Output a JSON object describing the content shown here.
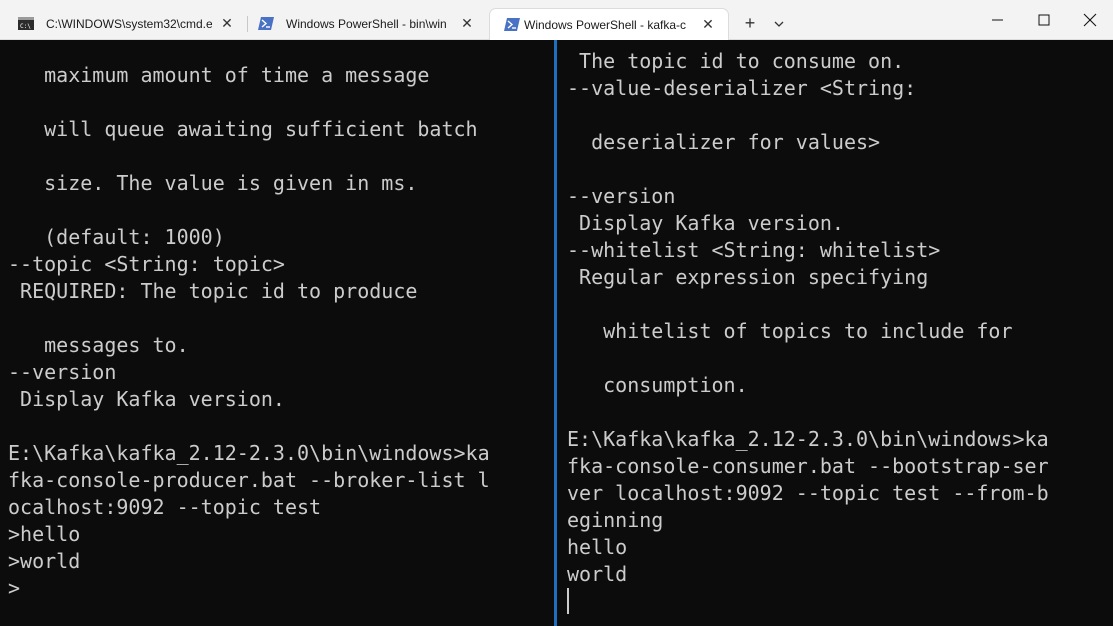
{
  "tabs": [
    {
      "title": "C:\\WINDOWS\\system32\\cmd.e",
      "icon": "cmd-icon",
      "active": false
    },
    {
      "title": "Windows PowerShell - bin\\win",
      "icon": "powershell-icon",
      "active": false
    },
    {
      "title": "Windows PowerShell - kafka-c",
      "icon": "powershell-icon",
      "active": true
    }
  ],
  "titlebar": {
    "new_tab": "+",
    "close_glyph": "✕"
  },
  "left_pane": {
    "lines": [
      "",
      "   maximum amount of time a message",
      "",
      "   will queue awaiting sufficient batch",
      "",
      "   size. The value is given in ms.",
      "",
      "   (default: 1000)",
      "--topic <String: topic>",
      " REQUIRED: The topic id to produce",
      "",
      "   messages to.",
      "--version",
      " Display Kafka version.",
      "",
      "E:\\Kafka\\kafka_2.12-2.3.0\\bin\\windows>ka",
      "fka-console-producer.bat --broker-list l",
      "ocalhost:9092 --topic test",
      ">hello",
      ">world",
      ">"
    ]
  },
  "right_pane": {
    "lines": [
      " The topic id to consume on.",
      "--value-deserializer <String:",
      "",
      "  deserializer for values>",
      "",
      "--version",
      " Display Kafka version.",
      "--whitelist <String: whitelist>",
      " Regular expression specifying",
      "",
      "   whitelist of topics to include for",
      "",
      "   consumption.",
      "",
      "E:\\Kafka\\kafka_2.12-2.3.0\\bin\\windows>ka",
      "fka-console-consumer.bat --bootstrap-ser",
      "ver localhost:9092 --topic test --from-b",
      "eginning",
      "hello",
      "world"
    ]
  },
  "colors": {
    "terminal_bg": "#0c0c0c",
    "terminal_fg": "#cccccc",
    "pane_divider": "#1f6fbf",
    "titlebar_bg": "#f3f3f3"
  }
}
